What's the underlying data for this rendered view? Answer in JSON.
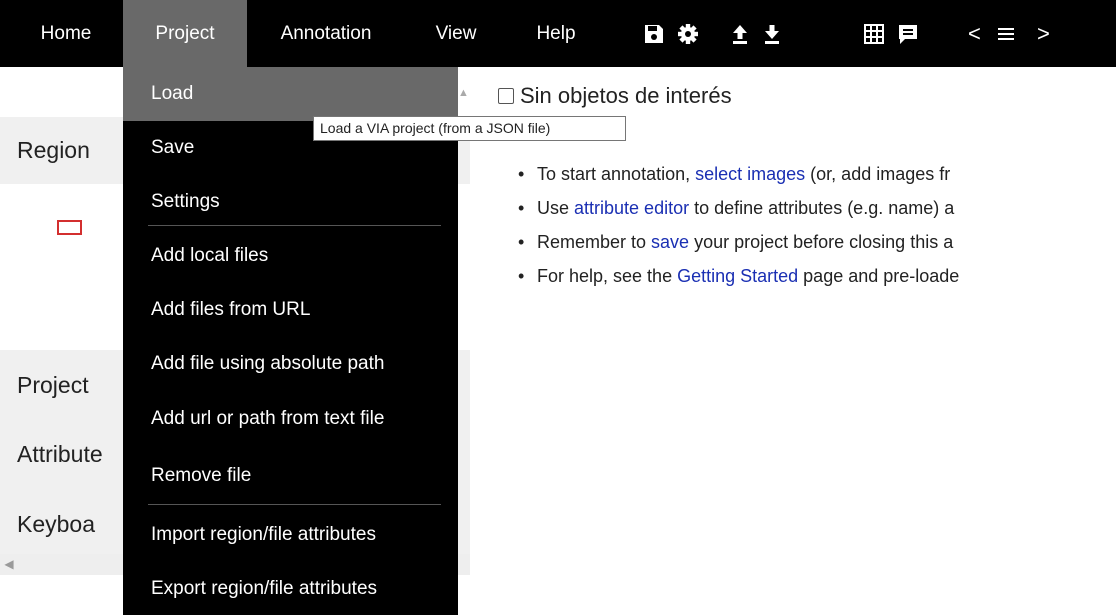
{
  "menubar": {
    "items": [
      {
        "label": "Home"
      },
      {
        "label": "Project"
      },
      {
        "label": "Annotation"
      },
      {
        "label": "View"
      },
      {
        "label": "Help"
      }
    ],
    "icons": [
      "save-icon",
      "settings-gear-icon",
      "upload-icon",
      "download-icon",
      "grid-view-icon",
      "comment-icon",
      "previous-chevron-icon",
      "list-icon",
      "next-chevron-icon"
    ],
    "prev_glyph": "<",
    "next_glyph": ">"
  },
  "project_menu": {
    "items": [
      {
        "label": "Load"
      },
      {
        "label": "Save"
      },
      {
        "label": "Settings"
      },
      {
        "label": "Add local files"
      },
      {
        "label": "Add files from URL"
      },
      {
        "label": "Add file using absolute path"
      },
      {
        "label": "Add url or path from text file"
      },
      {
        "label": "Remove file"
      },
      {
        "label": "Import region/file attributes"
      },
      {
        "label": "Export region/file attributes"
      }
    ],
    "hovered_index": 0
  },
  "tooltip": "Load a VIA project (from a JSON file)",
  "sidebar": {
    "region_label": "Region",
    "project_label": "Project",
    "attributes_label": "Attribute",
    "keyboard_label": "Keyboa"
  },
  "main": {
    "checkbox_label": "Sin objetos de interés",
    "checkbox_checked": false,
    "bullets": [
      {
        "pre": "To start annotation, ",
        "link": "select images",
        "post": " (or, add images fr"
      },
      {
        "pre": "Use ",
        "link": "attribute editor",
        "post": " to define attributes (e.g. name) a"
      },
      {
        "pre": "Remember to ",
        "link": "save",
        "post": " your project before closing this a"
      },
      {
        "pre": "For help, see the ",
        "link": "Getting Started",
        "post": " page and pre-loade"
      }
    ]
  },
  "colors": {
    "menubar_bg": "#000000",
    "active_bg": "#696969",
    "link": "#1a2fb3",
    "region_shape": "#d32f2f",
    "sidebar_row_bg": "#f0f0f0"
  }
}
